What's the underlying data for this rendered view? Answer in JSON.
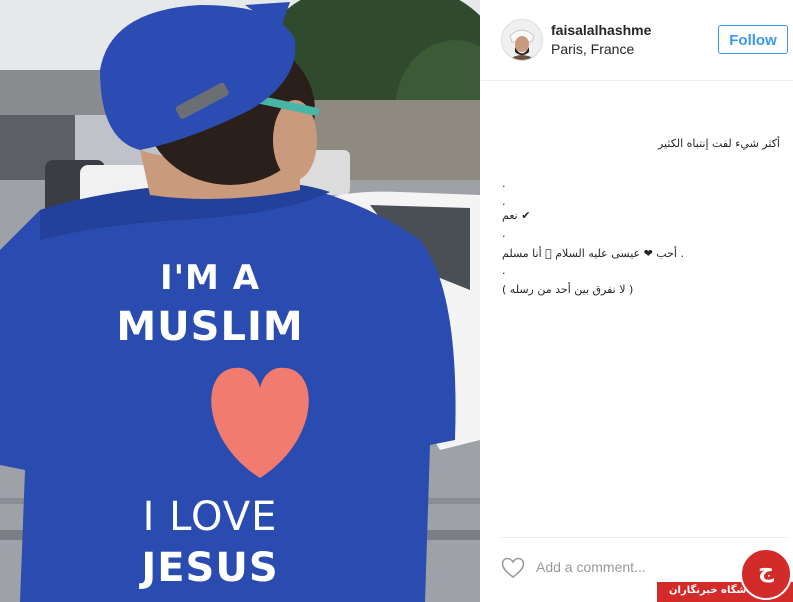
{
  "post": {
    "username": "faisalalhashme",
    "location": "Paris, France",
    "follow_label": "Follow"
  },
  "photo": {
    "shirt_line1": "I'M A",
    "shirt_line2": "MUSLIM",
    "shirt_line3": "I LOVE",
    "shirt_line4": "JESUS"
  },
  "caption": {
    "line1": "أكثر شيء لفت إنتباه الكثير",
    "line2": ".",
    "line3": ".",
    "line4": "نعم ✔",
    "line5": ".",
    "line6": "أحب ❤ عيسى عليه السلام 🏻 أنا مسلم .",
    "line7": ".",
    "line8": "( لا نفرق بين أحد من رسله )"
  },
  "comment": {
    "placeholder": "Add a comment..."
  },
  "watermark": {
    "text": "باشگاه خبرنگاران",
    "logo_letter": "ج"
  },
  "colors": {
    "shirt_blue": "#2a4bb0",
    "follow_blue": "#3897f0",
    "heart_pink": "#f07b6e",
    "watermark_red": "#d32a2a"
  },
  "icons": {
    "like": "heart-outline-icon",
    "avatar": "user-avatar"
  }
}
